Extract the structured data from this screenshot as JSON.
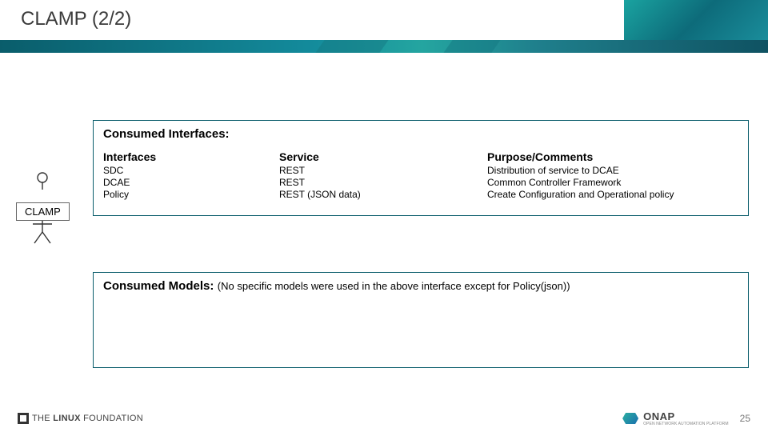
{
  "slide": {
    "title": "CLAMP (2/2)",
    "page_number": "25"
  },
  "actor": {
    "label": "CLAMP"
  },
  "consumed_interfaces": {
    "heading": "Consumed Interfaces:",
    "columns": {
      "interfaces_head": "Interfaces",
      "service_head": "Service",
      "purpose_head": "Purpose/Comments"
    },
    "rows": [
      {
        "interface": "SDC",
        "service": "REST",
        "purpose": "Distribution of service to DCAE"
      },
      {
        "interface": "DCAE",
        "service": "REST",
        "purpose": "Common Controller Framework"
      },
      {
        "interface": "Policy",
        "service": "REST (JSON data)",
        "purpose": "Create Configuration and Operational policy"
      }
    ]
  },
  "consumed_models": {
    "heading": "Consumed Models:",
    "note": "(No specific models were used in the above interface except for Policy(json))"
  },
  "footer": {
    "linux_foundation": "THE LINUX FOUNDATION",
    "onap": "ONAP",
    "onap_sub": "OPEN NETWORK AUTOMATION PLATFORM"
  }
}
